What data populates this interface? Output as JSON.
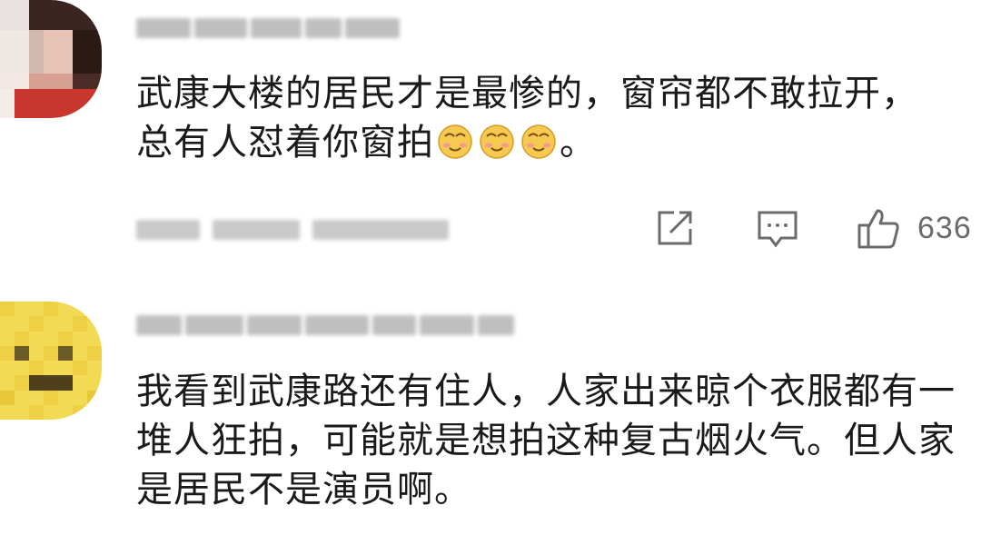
{
  "comments": [
    {
      "username": "",
      "text_parts": [
        "武康大楼的居民才是最惨的，窗帘都不敢拉开，总有人怼着你窗拍",
        "。"
      ],
      "emoji_count": 3,
      "emoji_name": "awkward-smile-emoji",
      "meta": "",
      "actions": {
        "share_icon": "share-icon",
        "reply_icon": "comment-icon",
        "like_icon": "thumbs-up-icon",
        "like_count": "636"
      }
    },
    {
      "username": "",
      "text": "我看到武康路还有住人，人家出来晾个衣服都有一堆人狂拍，可能就是想拍这种复古烟火气。但人家是居民不是演员啊。"
    }
  ],
  "colors": {
    "text": "#1a1a1a",
    "muted": "#6b6b6b",
    "blurred": "#bfbfbf",
    "emoji_face": "#f6c950",
    "avatar2": "#f2d64e"
  }
}
